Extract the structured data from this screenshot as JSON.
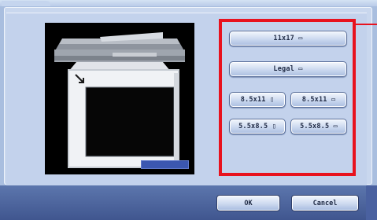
{
  "paper_sizes": {
    "buttons": [
      {
        "label": "11x17 ▭"
      },
      {
        "label": "Legal ▭"
      },
      {
        "label": "8.5x11 ▯"
      },
      {
        "label": "8.5x11 ▭"
      },
      {
        "label": "5.5x8.5 ▯"
      },
      {
        "label": "5.5x8.5 ▭"
      }
    ]
  },
  "actions": {
    "ok_label": "OK",
    "cancel_label": "Cancel"
  },
  "icons": {
    "preview": "printer-icon",
    "arrow": "arrow-down-right-icon"
  },
  "colors": {
    "highlight": "#e8121e",
    "accent_blue": "#3b57b0"
  }
}
